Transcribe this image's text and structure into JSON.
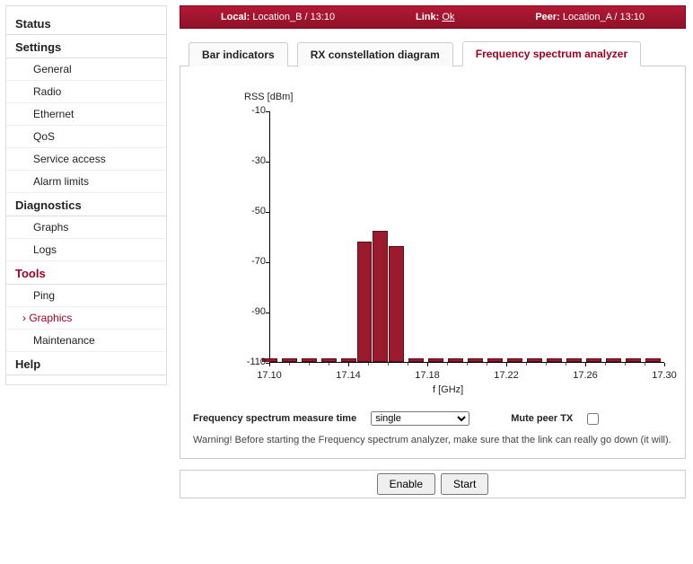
{
  "sidebar": {
    "groups": [
      {
        "label": "Status",
        "active": false,
        "items": []
      },
      {
        "label": "Settings",
        "active": false,
        "items": [
          {
            "label": "General"
          },
          {
            "label": "Radio"
          },
          {
            "label": "Ethernet"
          },
          {
            "label": "QoS"
          },
          {
            "label": "Service access"
          },
          {
            "label": "Alarm limits"
          }
        ]
      },
      {
        "label": "Diagnostics",
        "active": false,
        "items": [
          {
            "label": "Graphs"
          },
          {
            "label": "Logs"
          }
        ]
      },
      {
        "label": "Tools",
        "active": true,
        "items": [
          {
            "label": "Ping"
          },
          {
            "label": "Graphics",
            "active": true
          },
          {
            "label": "Maintenance"
          }
        ]
      },
      {
        "label": "Help",
        "active": false,
        "items": []
      }
    ]
  },
  "status": {
    "local_label": "Local:",
    "local_value": "Location_B / 13:10",
    "link_label": "Link:",
    "link_value": "Ok",
    "peer_label": "Peer:",
    "peer_value": "Location_A / 13:10"
  },
  "tabs": [
    {
      "label": "Bar indicators"
    },
    {
      "label": "RX constellation diagram"
    },
    {
      "label": "Frequency spectrum analyzer",
      "active": true
    }
  ],
  "controls": {
    "measure_time_label": "Frequency spectrum measure time",
    "measure_time_value": "single",
    "mute_label": "Mute peer TX",
    "mute_checked": false,
    "warning": "Warning! Before starting the Frequency spectrum analyzer, make sure that the link can really go down (it will)."
  },
  "buttons": {
    "enable": "Enable",
    "start": "Start"
  },
  "chart_data": {
    "type": "bar",
    "title": "",
    "ylabel": "RSS [dBm]",
    "xlabel": "f [GHz]",
    "ylim": [
      -110,
      -10
    ],
    "y_ticks": [
      -10,
      -30,
      -50,
      -70,
      -90,
      -110
    ],
    "xlim": [
      17.1,
      17.3
    ],
    "x_ticks": [
      17.1,
      17.14,
      17.18,
      17.22,
      17.26,
      17.3
    ],
    "x_minor_step": 0.01,
    "bar_width_ghz": 0.008,
    "series": [
      {
        "name": "RSS",
        "x": [
          17.1,
          17.11,
          17.12,
          17.13,
          17.14,
          17.148,
          17.156,
          17.164,
          17.174,
          17.184,
          17.194,
          17.204,
          17.214,
          17.224,
          17.234,
          17.244,
          17.254,
          17.264,
          17.274,
          17.284,
          17.294
        ],
        "values": [
          -110,
          -110,
          -110,
          -110,
          -110,
          -62,
          -58,
          -64,
          -110,
          -110,
          -110,
          -110,
          -110,
          -110,
          -110,
          -110,
          -110,
          -110,
          -110,
          -110,
          -110
        ]
      }
    ]
  }
}
